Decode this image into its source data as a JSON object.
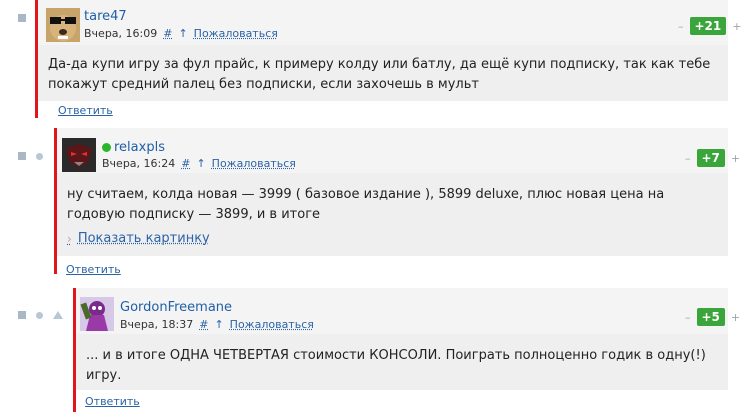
{
  "comments": [
    {
      "username": "tare47",
      "online": false,
      "time": "Вчера, 16:09",
      "hash": "#",
      "up_arrow": "↑",
      "report": "Пожаловаться",
      "score": "+21",
      "minus": "–",
      "text": "Да-да купи игру за фул прайс, к примеру колду или батлу, да ещё купи подписку, так как тебе покажут средний палец без подписки, если захочешь в мульт",
      "reply": "Ответить",
      "avatar_icon": "glasses-dog-avatar"
    },
    {
      "username": "relaxpls",
      "online": true,
      "time": "Вчера, 16:24",
      "hash": "#",
      "up_arrow": "↑",
      "report": "Пожаловаться",
      "score": "+7",
      "minus": "–",
      "text": "ну считаем, колда новая — 3999 ( базовое издание ), 5899 deluxe, плюс новая цена на годовую подписку — 3899, и в итоге",
      "show_picture": "Показать картинку",
      "reply": "Ответить",
      "avatar_icon": "dark-mask-avatar"
    },
    {
      "username": "GordonFreemane",
      "online": false,
      "time": "Вчера, 18:37",
      "hash": "#",
      "up_arrow": "↑",
      "report": "Пожаловаться",
      "score": "+5",
      "minus": "–",
      "text": "... и в итоге ОДНА ЧЕТВЕРТАЯ стоимости КОНСОЛИ. Поиграть полноценно годик в одну(!) игру.",
      "reply": "Ответить",
      "avatar_icon": "purple-character-avatar"
    }
  ],
  "colors": {
    "accent_red": "#e0161b",
    "badge_green": "#3aa53a",
    "link_blue": "#2a63a6",
    "online_green": "#2ab52a"
  }
}
